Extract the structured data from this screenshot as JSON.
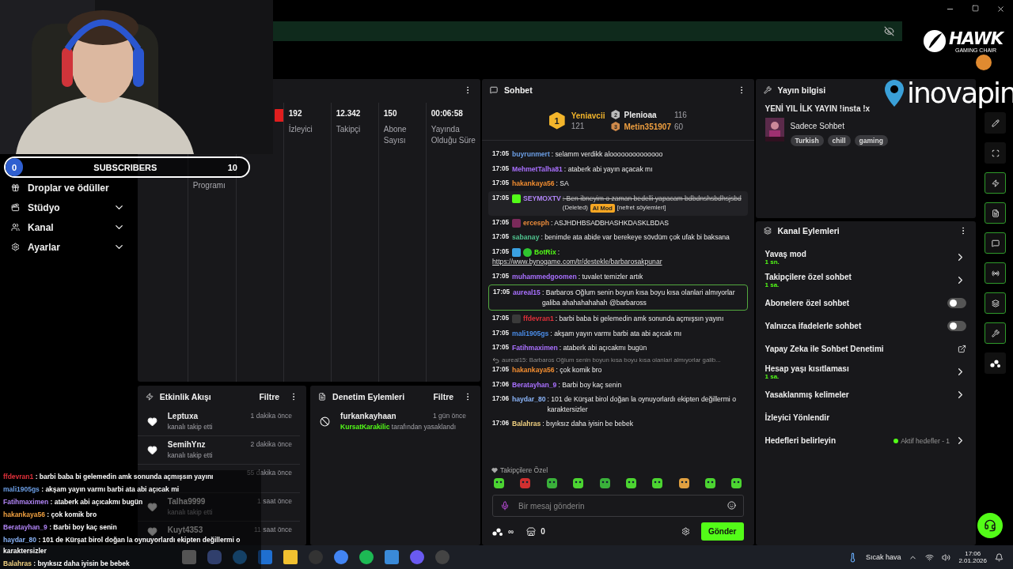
{
  "sidebar": {
    "items": [
      {
        "label": "Droplar ve ödüller"
      },
      {
        "label": "Stüdyo",
        "expanded": false
      },
      {
        "label": "Kanal",
        "expanded": false
      },
      {
        "label": "Ayarlar",
        "expanded": false
      }
    ]
  },
  "stats": {
    "column_label": "Programı",
    "items": [
      {
        "value": "192",
        "label": "İzleyici"
      },
      {
        "value": "12.342",
        "label": "Takipçi"
      },
      {
        "value": "150",
        "label": "Abone Sayısı"
      },
      {
        "value": "00:06:58",
        "label": "Yayında Olduğu Süre"
      }
    ]
  },
  "activity_feed": {
    "title": "Etkinlik Akışı",
    "filter": "Filtre",
    "items": [
      {
        "user": "Leptuxa",
        "time": "1 dakika önce",
        "action": "kanalı takip etti"
      },
      {
        "user": "SemihYnz",
        "time": "2 dakika önce",
        "action": "kanalı takip etti"
      },
      {
        "time": "55 dakika önce"
      },
      {
        "user": "Talha9999",
        "time": "1 saat önce",
        "action": "kanalı takip etti"
      },
      {
        "user": "Kuyt4353",
        "time": "11 saat önce"
      }
    ]
  },
  "moderation": {
    "title": "Denetim Eylemleri",
    "filter": "Filtre",
    "items": [
      {
        "user": "furkankayhaan",
        "time": "1 gün önce",
        "moderator": "KursatKarakilic",
        "action": "tarafından yasaklandı"
      }
    ]
  },
  "chat": {
    "title": "Sohbet",
    "top_gifters": [
      {
        "rank": "1",
        "name": "Yeniavcii",
        "count": "121"
      },
      {
        "rank": "2",
        "name": "Plenioaa",
        "count": "116"
      },
      {
        "rank": "3",
        "name": "Metin351907",
        "count": "60"
      }
    ],
    "messages": [
      {
        "kind": "normal",
        "time": "17:05",
        "user": "buyrunmert",
        "color": "#6c9fe6",
        "text": ": selamm verdikk aloooooooooooooo"
      },
      {
        "kind": "normal",
        "time": "17:05",
        "user": "MehmetTalha81",
        "color": "#a970ff",
        "text": ": ataberk abi yayın açacak mı"
      },
      {
        "kind": "normal",
        "time": "17:05",
        "user": "hakankaya56",
        "color": "#f08c30",
        "text": ": SA"
      },
      {
        "kind": "deleted",
        "time": "17:05",
        "user": "SEYMOXTV",
        "color": "#b084f5",
        "badges": [
          {
            "kind": "gift"
          }
        ],
        "text": ": Ben ibneyim o zaman bedelli yapacam bdbdnshsbdhsjsbd",
        "note": "(Deleted)",
        "tag": "AI Mod",
        "reason": "[nefret söylemleri]"
      },
      {
        "kind": "normal",
        "time": "17:05",
        "user": "ercesph",
        "color": "#e88a3a",
        "badges": [
          {
            "kind": "letter"
          }
        ],
        "text": ": ASJHDHBSADBHASHKDASKLBDAS"
      },
      {
        "kind": "normal",
        "time": "17:05",
        "user": "sabanay",
        "color": "#4fc08d",
        "text": ": benimde ata abide var berekeye sövdüm çok ufak bi baksana"
      },
      {
        "kind": "link",
        "time": "17:05",
        "user": "BotRix",
        "color": "#53fc18",
        "badges": [
          {
            "kind": "hammer"
          },
          {
            "kind": "verified"
          }
        ],
        "text": ":",
        "link": "https://www.bynogame.com/tr/destekle/barbarosakpunar"
      },
      {
        "kind": "normal",
        "time": "17:05",
        "user": "muhammedgoomen",
        "color": "#a970ff",
        "text": ": tuvalet temizler artık"
      },
      {
        "kind": "highlighted",
        "time": "17:05",
        "user": "aureal15",
        "color": "#a970ff",
        "text": ": Barbaros Oğlum senin boyun kısa boyu kısa olanlari almıyorlar galiba ahahahahahah @barbaross"
      },
      {
        "kind": "normal",
        "time": "17:05",
        "user": "ffdevran1",
        "color": "#e0303a",
        "badges": [
          {
            "kind": "shadow"
          }
        ],
        "text": ": barbi baba bi gelemedin amk sonunda açmışsın yayını"
      },
      {
        "kind": "normal",
        "time": "17:05",
        "user": "mali1905gs",
        "color": "#4a8ce8",
        "text": ": akşam yayın varmı barbi ata abi açıcak mı"
      },
      {
        "kind": "normal",
        "time": "17:05",
        "user": "Fatihmaximen",
        "color": "#a970ff",
        "text": ": ataberk abi açıcakmı bugün"
      },
      {
        "kind": "reply",
        "time": "17:05",
        "user": "hakankaya56",
        "color": "#f08c30",
        "reply_to": "aureal15: Barbaros Oğlum senin boyun kısa boyu kısa olanlari almıyorlar galib...",
        "text": ": çok komik bro"
      },
      {
        "kind": "normal",
        "time": "17:06",
        "user": "Beratayhan_9",
        "color": "#a970ff",
        "text": ": Barbi boy kaç senin"
      },
      {
        "kind": "normal",
        "time": "17:06",
        "user": "haydar_80",
        "color": "#8ab4f8",
        "text": ": 101 de Kürşat birol doğan la oynuyorlardı ekipten değillermi o karaktersizler"
      },
      {
        "kind": "normal",
        "time": "17:06",
        "user": "Balahras",
        "color": "#f0d080",
        "text": ": bıyıksız daha iyisin be bebek"
      }
    ],
    "follower_label": "Takipçilere Özel",
    "placeholder": "Bir mesaj gönderin",
    "points": "∞",
    "store_count": "0",
    "send": "Gönder"
  },
  "stream_info": {
    "title": "Yayın bilgisi",
    "stream_title": "YENİ YIL İLK YAYIN !insta !x",
    "category": "Sadece Sohbet",
    "tags": [
      "Turkish",
      "chill",
      "gaming"
    ]
  },
  "channel_actions": {
    "title": "Kanal Eylemleri",
    "items": [
      {
        "kind": "link",
        "label": "Yavaş mod",
        "value": "1 sn."
      },
      {
        "kind": "link",
        "label": "Takipçilere özel sohbet",
        "value": "1 sa."
      },
      {
        "kind": "toggle",
        "label": "Abonelere özel sohbet",
        "on": false
      },
      {
        "kind": "toggle",
        "label": "Yalnızca ifadelerle sohbet",
        "on": false
      },
      {
        "kind": "external",
        "label": "Yapay Zeka ile Sohbet Denetimi"
      },
      {
        "kind": "link",
        "label": "Hesap yaşı kısıtlaması",
        "value": "1 sa."
      },
      {
        "kind": "link",
        "label": "Yasaklanmış kelimeler"
      },
      {
        "kind": "plain",
        "label": "İzleyici Yönlendir"
      },
      {
        "kind": "link",
        "label": "Hedefleri belirleyin",
        "status": "Aktif hedefler - 1"
      }
    ]
  },
  "tools": [
    {
      "active": false
    },
    {
      "active": false
    },
    {
      "active": true
    },
    {
      "active": true
    },
    {
      "active": true
    },
    {
      "active": true
    },
    {
      "active": true
    },
    {
      "active": true
    },
    {
      "active": false
    }
  ],
  "subscriber_goal": {
    "current": "0",
    "label": "SUBSCRIBERS",
    "goal": "10",
    "level": 0
  },
  "chat_overlay": {
    "lines": [
      {
        "user": "ffdevran1",
        "color": "#e0303a",
        "text": " : barbi baba bi gelemedin amk sonunda açmışsın yayını"
      },
      {
        "user": "mali1905gs",
        "color": "#6c9fe6",
        "text": " : akşam yayın varmı barbi ata abi açıcak mi"
      },
      {
        "user": "Fatihmaximen",
        "color": "#b084f5",
        "text": " : ataberk abi açıcakmı bugün"
      },
      {
        "user": "hakankaya56",
        "color": "#f0a040",
        "text": " : çok komik bro"
      },
      {
        "user": "Beratayhan_9",
        "color": "#b084f5",
        "text": " : Barbi boy kaç senin"
      },
      {
        "user": "haydar_80",
        "color": "#8ab4f8",
        "text": " : 101 de Kürşat birol doğan la oynuyorlardı ekipten değillermi o karaktersizler"
      },
      {
        "user": "Balahras",
        "color": "#f0d080",
        "text": " : bıyıksız daha iyisin be bebek"
      }
    ]
  },
  "logos": {
    "sponsor_top": "HAWK",
    "sponsor_top_sub": "GAMING CHAIR",
    "sponsor": "inovapin"
  },
  "taskbar": {
    "weather": "Sıcak hava",
    "time": "17:06",
    "date": "2.01.2026"
  }
}
